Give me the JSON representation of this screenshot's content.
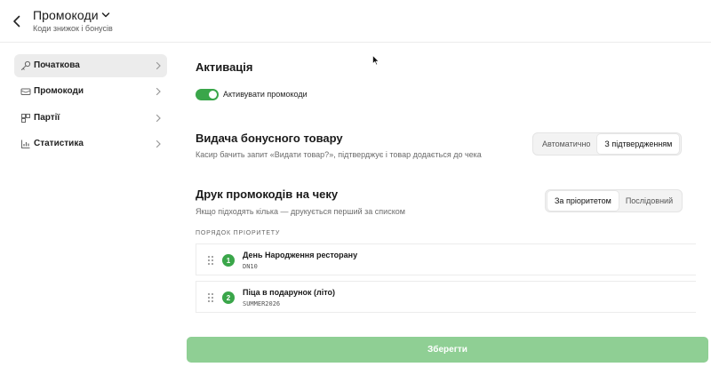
{
  "header": {
    "title": "Промокоди",
    "subtitle": "Коди знижок і бонусів"
  },
  "sidebar": {
    "items": [
      {
        "label": "Початкова",
        "icon": "key-icon",
        "active": true
      },
      {
        "label": "Промокоди",
        "icon": "ticket-icon",
        "active": false
      },
      {
        "label": "Партії",
        "icon": "batches-icon",
        "active": false
      },
      {
        "label": "Статистика",
        "icon": "chart-icon",
        "active": false
      }
    ]
  },
  "activation": {
    "title": "Активація",
    "toggle_label": "Активувати промокоди",
    "toggle_on": true
  },
  "bonus": {
    "title": "Видача бонусного товару",
    "description": "Касир бачить запит «Видати товар?», підтверджує і товар додається до чека",
    "options": [
      "Автоматично",
      "З підтвердженням"
    ],
    "selected": "З підтвердженням"
  },
  "print": {
    "title": "Друк промокодів на чеку",
    "description": "Якщо підходять кілька — друкується перший за списком",
    "options": [
      "За пріоритетом",
      "Послідовний"
    ],
    "selected": "За пріоритетом"
  },
  "priority": {
    "label": "ПОРЯДОК ПРІОРИТЕТУ",
    "items": [
      {
        "num": "1",
        "name": "День Народження ресторану",
        "code": "DN10"
      },
      {
        "num": "2",
        "name": "Піца в подарунок (літо)",
        "code": "SUMMER2026"
      }
    ]
  },
  "save_label": "Зберегти",
  "colors": {
    "accent": "#3aa64a",
    "save_button": "#8fcf94",
    "active_nav": "#ececec"
  }
}
